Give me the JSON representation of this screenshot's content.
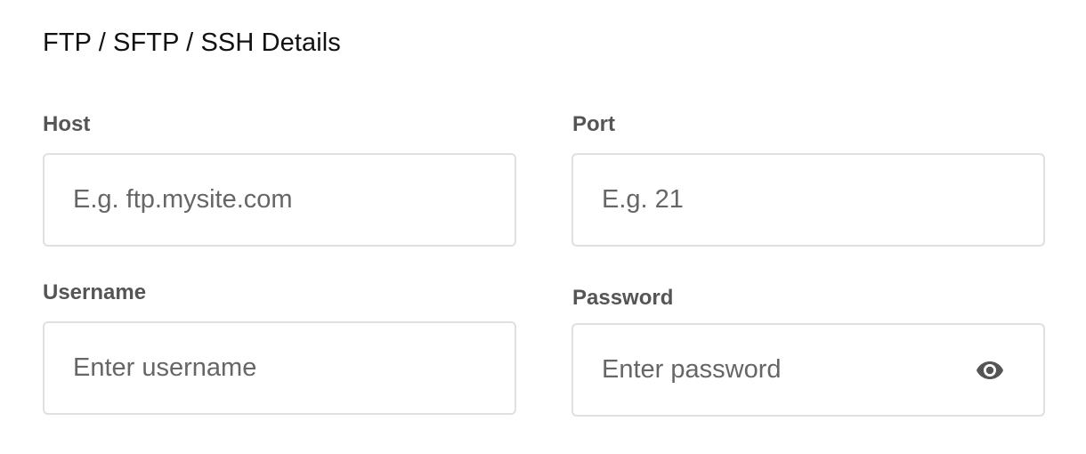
{
  "section": {
    "title": "FTP / SFTP / SSH Details"
  },
  "host": {
    "label": "Host",
    "placeholder": "E.g. ftp.mysite.com",
    "value": ""
  },
  "port": {
    "label": "Port",
    "placeholder": "E.g. 21",
    "value": ""
  },
  "username": {
    "label": "Username",
    "placeholder": "Enter username",
    "value": ""
  },
  "password": {
    "label": "Password",
    "placeholder": "Enter password",
    "value": "",
    "toggle_icon": "eye-icon"
  },
  "colors": {
    "label_text": "#555555",
    "border": "#e0e0e0",
    "title_text": "#111111"
  }
}
